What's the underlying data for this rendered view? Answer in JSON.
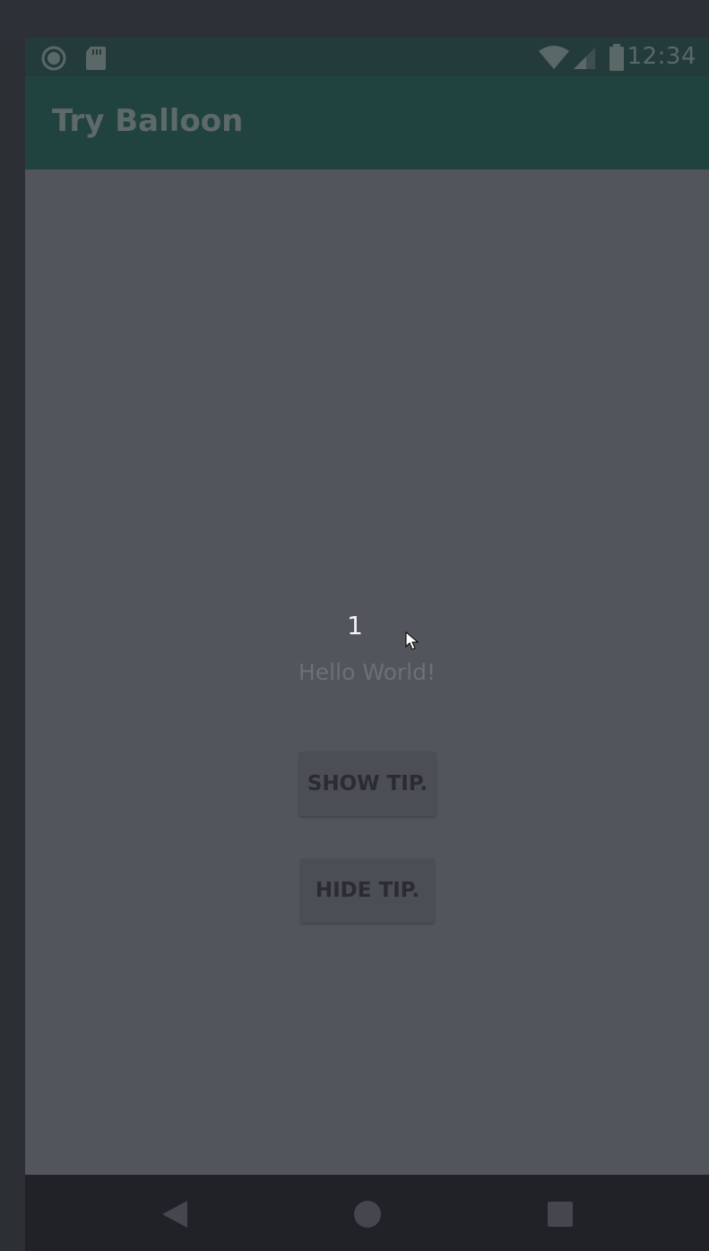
{
  "status_bar": {
    "time": "12:34",
    "left_icons": [
      "record-icon",
      "sd-card-icon"
    ],
    "right_icons": [
      "wifi-icon",
      "signal-icon",
      "battery-icon"
    ]
  },
  "app_bar": {
    "title": "Try Balloon"
  },
  "main": {
    "counter": "1",
    "hello_text": "Hello World!",
    "show_tip_label": "SHOW TIP.",
    "hide_tip_label": "HIDE TIP."
  },
  "nav_bar": {
    "buttons": [
      "back-icon",
      "home-icon",
      "recents-icon"
    ]
  },
  "colors": {
    "status_bar": "#233c3b",
    "app_bar": "#21433f",
    "content_bg": "#52555c",
    "nav_bar": "#202227"
  }
}
